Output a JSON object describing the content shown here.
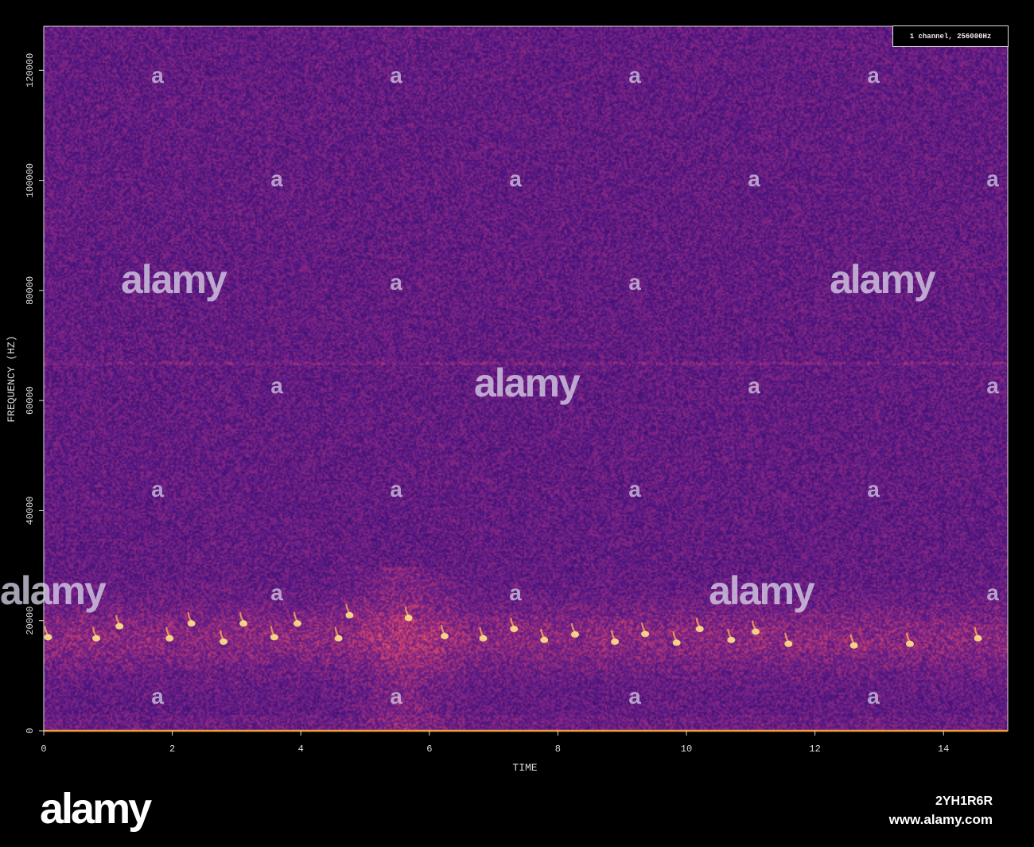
{
  "chart_data": {
    "type": "heatmap",
    "subtype": "spectrogram",
    "title": "",
    "xlabel": "TIME",
    "ylabel": "FREQUENCY (HZ)",
    "xlim": [
      0,
      15
    ],
    "ylim": [
      0,
      128000
    ],
    "x_ticks": [
      0,
      2,
      4,
      6,
      8,
      10,
      12,
      14
    ],
    "y_ticks": [
      0,
      20000,
      40000,
      60000,
      80000,
      100000,
      120000
    ],
    "legend_text": "1 channel, 256000Hz",
    "legend_placement": "top-right",
    "colormap": [
      "#000004",
      "#3b0f70",
      "#5a1a86",
      "#8c2981",
      "#de4968",
      "#fe9f6d",
      "#fcfdbf"
    ],
    "background_intensity": 0.35,
    "tone_line_hz": 67000,
    "energy_band_hz": [
      10000,
      25000
    ],
    "calls_low": [
      {
        "t": 0.03,
        "f": 17000
      },
      {
        "t": 0.78,
        "f": 16800
      },
      {
        "t": 1.92,
        "f": 16800
      },
      {
        "t": 2.76,
        "f": 16200
      },
      {
        "t": 3.55,
        "f": 17000
      },
      {
        "t": 4.55,
        "f": 16800
      },
      {
        "t": 6.2,
        "f": 17200
      },
      {
        "t": 6.8,
        "f": 16800
      },
      {
        "t": 7.75,
        "f": 16500
      },
      {
        "t": 8.23,
        "f": 17500
      },
      {
        "t": 8.85,
        "f": 16200
      },
      {
        "t": 9.32,
        "f": 17600
      },
      {
        "t": 9.81,
        "f": 16000
      },
      {
        "t": 10.66,
        "f": 16500
      },
      {
        "t": 11.55,
        "f": 15800
      },
      {
        "t": 12.57,
        "f": 15500
      },
      {
        "t": 13.44,
        "f": 15800
      },
      {
        "t": 14.5,
        "f": 16800
      }
    ],
    "calls_high": [
      {
        "t": 1.14,
        "f": 19000
      },
      {
        "t": 2.26,
        "f": 19500
      },
      {
        "t": 3.07,
        "f": 19500
      },
      {
        "t": 3.91,
        "f": 19500
      },
      {
        "t": 4.72,
        "f": 21000
      },
      {
        "t": 5.64,
        "f": 20500
      },
      {
        "t": 7.28,
        "f": 18500
      },
      {
        "t": 10.17,
        "f": 18500
      },
      {
        "t": 11.04,
        "f": 18000
      }
    ]
  },
  "watermark": {
    "logo": "alamy",
    "image_id": "2YH1R6R",
    "url": "www.alamy.com"
  }
}
